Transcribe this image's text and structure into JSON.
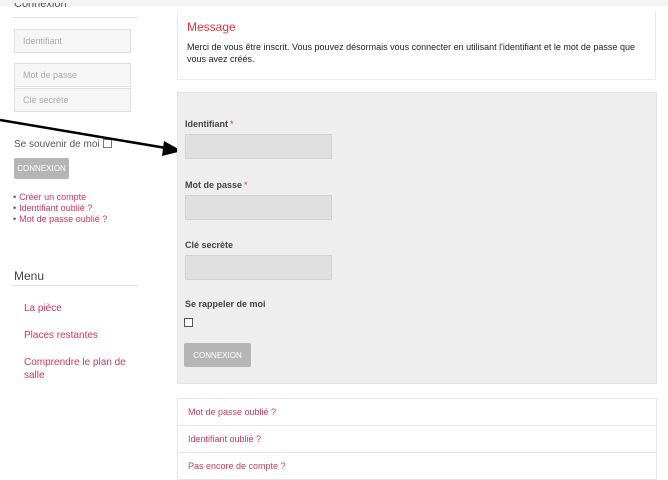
{
  "sidebar": {
    "heading": "Connexion",
    "username_placeholder": "Identifiant",
    "password_placeholder": "Mot de passe",
    "secret_placeholder": "Clé secrète",
    "remember_label": "Se souvenir de moi",
    "login_button": "CONNEXION",
    "links": [
      "Créer un compte",
      "Identifiant oublié ?",
      "Mot de passe oublié ?"
    ],
    "menu_title": "Menu",
    "menu_items": [
      "La pièce",
      "Places restantes",
      "Comprendre le plan de salle"
    ]
  },
  "message": {
    "title": "Message",
    "text": "Merci de vous être inscrit. Vous pouvez désormais vous connecter en utilisant l'identifiant et le mot de passe que vous avez créés."
  },
  "form": {
    "username_label": "Identifiant",
    "password_label": "Mot de passe",
    "required_marker": "*",
    "secret_label": "Clé secrète",
    "remember_label": "Se rappeler de moi",
    "login_button": "CONNEXION"
  },
  "account_links": [
    "Mot de passe oublié ?",
    "Identifiant oublié ?",
    "Pas encore de compte ?"
  ],
  "colors": {
    "accent": "#d2365a",
    "message_title": "#e4323b",
    "button": "#b5b5b5",
    "form_bg": "#eeeeee"
  }
}
